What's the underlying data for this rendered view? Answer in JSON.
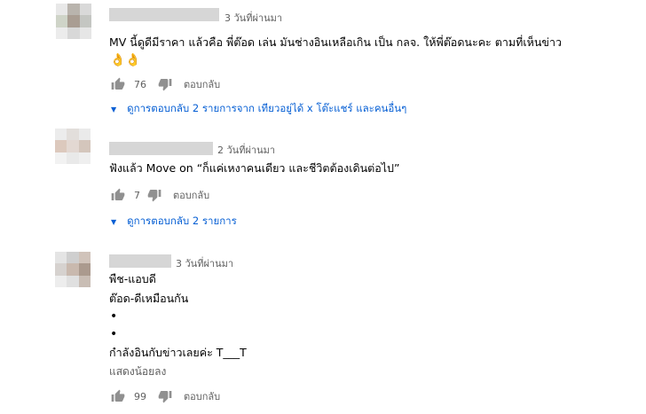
{
  "comments": [
    {
      "time": "3 วันที่ผ่านมา",
      "lines": [
        "MV นี้ดูดีมีราคา แล้วคือ พี่ต๊อด เล่น มันช่างอินเหลือเกิน เป็น กลจ. ให้พี่ต๊อดนะคะ ตามที่เห็นข่าว"
      ],
      "emoji": "👌👌",
      "likes": "76",
      "reply_label": "ตอบกลับ",
      "view_replies": "ดูการตอบกลับ 2 รายการจาก เทียวอยู่ได้ x โต๊ะแชร์ และคนอื่นๆ"
    },
    {
      "time": "2 วันที่ผ่านมา",
      "lines": [
        "ฟังแล้ว Move on “ก็แค่เหงาคนเดียว และชีวิตต้องเดินต่อไป”"
      ],
      "likes": "7",
      "reply_label": "ตอบกลับ",
      "view_replies": "ดูการตอบกลับ 2 รายการ"
    },
    {
      "time": "3 วันที่ผ่านมา",
      "lines": [
        "พืช-แอบดี",
        "ต๊อด-ดีเหมือนกัน",
        "•",
        "•",
        "กำลังอินกับข่าวเลยค่ะ T___T"
      ],
      "show_less": "แสดงน้อยลง",
      "likes": "99",
      "reply_label": "ตอบกลับ"
    }
  ],
  "icons": {
    "like": "thumb-up-icon",
    "dislike": "thumb-down-icon",
    "expand": "caret-down-icon"
  },
  "colors": {
    "link_blue": "#065fd4",
    "icon_gray": "#909090",
    "meta_gray": "#606060"
  }
}
